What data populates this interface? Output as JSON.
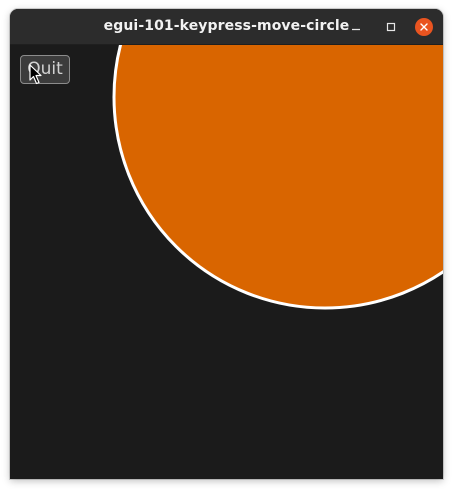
{
  "window": {
    "title": "egui-101-keypress-move-circle"
  },
  "controls": {
    "minimize_icon": "minimize-icon",
    "maximize_icon": "maximize-icon",
    "close_icon": "close-icon",
    "close_color": "#e95420"
  },
  "app": {
    "quit_label": "Quit",
    "background_color": "#1b1b1b",
    "circle_fill": "#d96500",
    "circle_stroke": "#ffffff"
  }
}
